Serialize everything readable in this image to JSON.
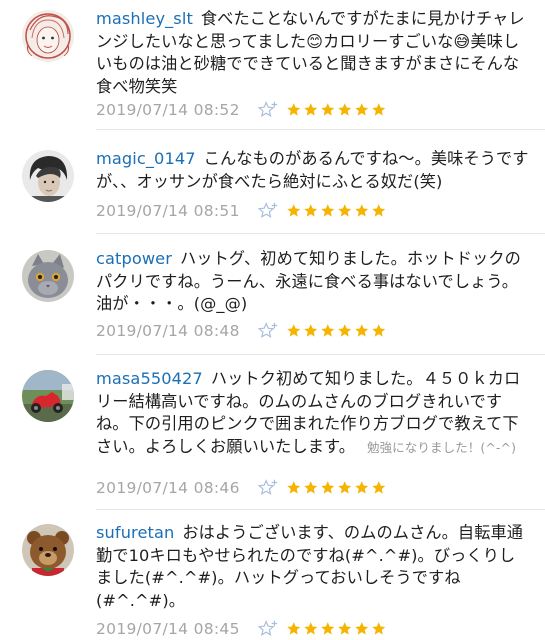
{
  "comments": [
    {
      "user": "mashley_slt",
      "text": "食べたことないんですがたまに見かけチャレンジしたいなと思ってました😊カロリーすごいな😅美味しいものは油と砂糖でできていると聞きますがまさにそんな食べ物笑笑",
      "note": "",
      "date": "2019/07/14 08:52",
      "rating": 6
    },
    {
      "user": "magic_0147",
      "text": "こんなものがあるんですね〜。美味そうですが、、オッサンが食べたら絶対にふとる奴だ(笑)",
      "note": "",
      "date": "2019/07/14 08:51",
      "rating": 6
    },
    {
      "user": "catpower",
      "text": "ハットグ、初めて知りました。ホットドックのパクリですね。うーん、永遠に食べる事はないでしょう。油が・・・。(@_@)",
      "note": "",
      "date": "2019/07/14 08:48",
      "rating": 6
    },
    {
      "user": "masa550427",
      "text": "ハットク初めて知りました。４５０ｋカロリー結構高いですね。のムのムさんのブログきれいですね。下の引用のピンクで囲まれた作り方ブログで教えて下さい。よろしくお願いいたします。",
      "note": "勉強になりました！(^-^)",
      "date": "2019/07/14 08:46",
      "rating": 6
    },
    {
      "user": "sufuretan",
      "text": "おはようございます、のムのムさん。自転車通勤で10キロもやせられたのですね(#^.^#)。びっくりしました(#^.^#)。ハットグっておいしそうですね(#^.^#)。",
      "note": "",
      "date": "2019/07/14 08:45",
      "rating": 6
    }
  ],
  "icons": {
    "add_star": "star-outline-plus-icon",
    "star": "star-filled-icon"
  },
  "colors": {
    "username": "#1a6fb5",
    "star": "#f5b400",
    "add_star_outline": "#a8bfdc",
    "date": "#a6a6a6"
  }
}
